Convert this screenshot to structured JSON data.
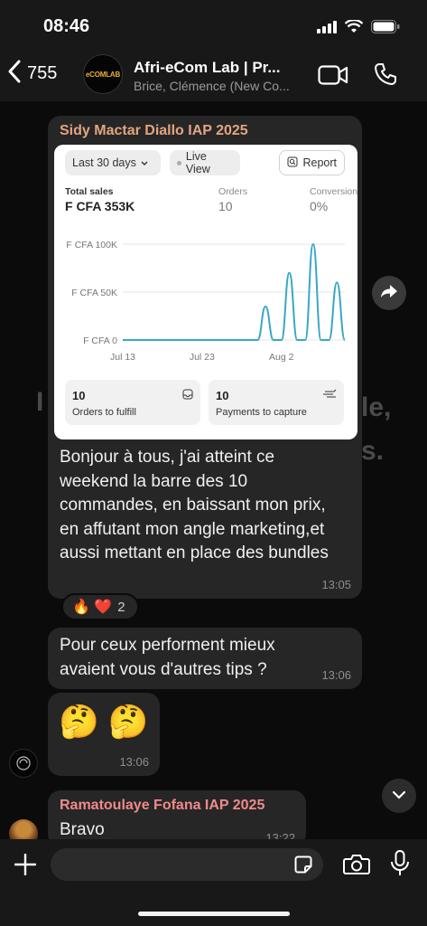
{
  "status_bar": {
    "time": "08:46"
  },
  "header": {
    "back_count": "755",
    "avatar_text": "eCOMLAB",
    "title": "Afri-eCom Lab | Pr...",
    "subtitle": "Brice, Clémence (New Co..."
  },
  "background_text": {
    "left": "I",
    "right_top": "le,",
    "right_bottom": "s."
  },
  "messages": [
    {
      "sender": "Sidy Mactar Diallo IAP 2025",
      "sender_color": "#e3a581",
      "text": "Bonjour à tous, j'ai atteint ce weekend la barre des 10 commandes, en baissant mon prix, en affutant mon angle marketing,et aussi mettant en place des bundles",
      "time": "13:05",
      "reactions": {
        "emojis": "🔥 ❤️",
        "count": "2"
      }
    },
    {
      "text": "Pour ceux performent mieux avaient vous d'autres tips ?",
      "time": "13:06"
    },
    {
      "emojis": "🤔 🤔",
      "time": "13:06"
    },
    {
      "sender": "Ramatoulaye Fofana IAP 2025",
      "sender_color": "#f08a8a",
      "text": "Bravo",
      "time": "13:22"
    }
  ],
  "shared_screenshot": {
    "date_range": "Last 30 days",
    "live_view": "Live View",
    "report": "Report",
    "metrics": [
      {
        "label": "Total sales",
        "value": "F CFA 353K"
      },
      {
        "label": "Orders",
        "value": "10"
      },
      {
        "label": "Conversion",
        "value": "0%"
      }
    ],
    "cards": [
      {
        "value": "10",
        "label": "Orders to fulfill"
      },
      {
        "value": "10",
        "label": "Payments to capture"
      }
    ],
    "chart_data": {
      "type": "line",
      "title": "",
      "x_ticks": [
        "Jul 13",
        "Jul 23",
        "Aug 2"
      ],
      "y_ticks": [
        "F CFA 0",
        "F CFA 50K",
        "F CFA 100K"
      ],
      "ylim": [
        0,
        100000
      ],
      "grid": true,
      "x_dates": [
        "Jul 13",
        "Jul 14",
        "Jul 15",
        "Jul 16",
        "Jul 17",
        "Jul 18",
        "Jul 19",
        "Jul 20",
        "Jul 21",
        "Jul 22",
        "Jul 23",
        "Jul 24",
        "Jul 25",
        "Jul 26",
        "Jul 27",
        "Jul 28",
        "Jul 29",
        "Jul 30",
        "Jul 31",
        "Aug 1",
        "Aug 2",
        "Aug 3",
        "Aug 4",
        "Aug 5",
        "Aug 6",
        "Aug 7",
        "Aug 8",
        "Aug 9",
        "Aug 10"
      ],
      "values": [
        0,
        0,
        0,
        0,
        0,
        0,
        0,
        0,
        0,
        0,
        0,
        0,
        0,
        0,
        0,
        0,
        0,
        0,
        35000,
        0,
        0,
        70000,
        0,
        0,
        100000,
        0,
        0,
        60000,
        0
      ],
      "color": "#3aa7c4"
    }
  },
  "colors": {
    "accent": "#3aa7c4",
    "bubble": "#262626"
  }
}
